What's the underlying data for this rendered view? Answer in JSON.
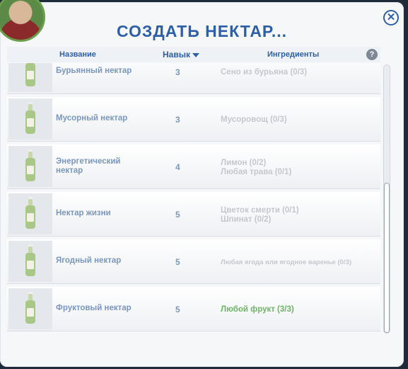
{
  "title": "СОЗДАТЬ НЕКТАР...",
  "header": {
    "name": "Название",
    "skill": "Навык",
    "ingredients": "Ингредиенты",
    "help": "?"
  },
  "close_label": "✕",
  "rows": [
    {
      "name_line1": "Бурьянный нектар",
      "name_line2": "",
      "skill": "3",
      "ing1": "Сено из бурьяна (0/3)",
      "ing2": "",
      "ing_style": ""
    },
    {
      "name_line1": "Мусорный нектар",
      "name_line2": "",
      "skill": "3",
      "ing1": "Мусоровощ (0/3)",
      "ing2": "",
      "ing_style": ""
    },
    {
      "name_line1": "Энергетический",
      "name_line2": "нектар",
      "skill": "4",
      "ing1": "Лимон (0/2)",
      "ing2": "Любая трава (0/1)",
      "ing_style": ""
    },
    {
      "name_line1": "Нектар жизни",
      "name_line2": "",
      "skill": "5",
      "ing1": "Цветок смерти (0/1)",
      "ing2": "Шпинат (0/2)",
      "ing_style": ""
    },
    {
      "name_line1": "Ягодный нектар",
      "name_line2": "",
      "skill": "5",
      "ing1": "Любая ягода или ягодное варенье (0/3)",
      "ing2": "",
      "ing_style": "small"
    },
    {
      "name_line1": "Фруктовый нектар",
      "name_line2": "",
      "skill": "5",
      "ing1": "Любой фрукт (3/3)",
      "ing2": "",
      "ing_style": "ok"
    }
  ],
  "colors": {
    "accent": "#2d5fa8",
    "muted_text": "#7a97c4",
    "ingredient_missing": "#c4c8cd",
    "ingredient_ok": "#6fb766"
  }
}
